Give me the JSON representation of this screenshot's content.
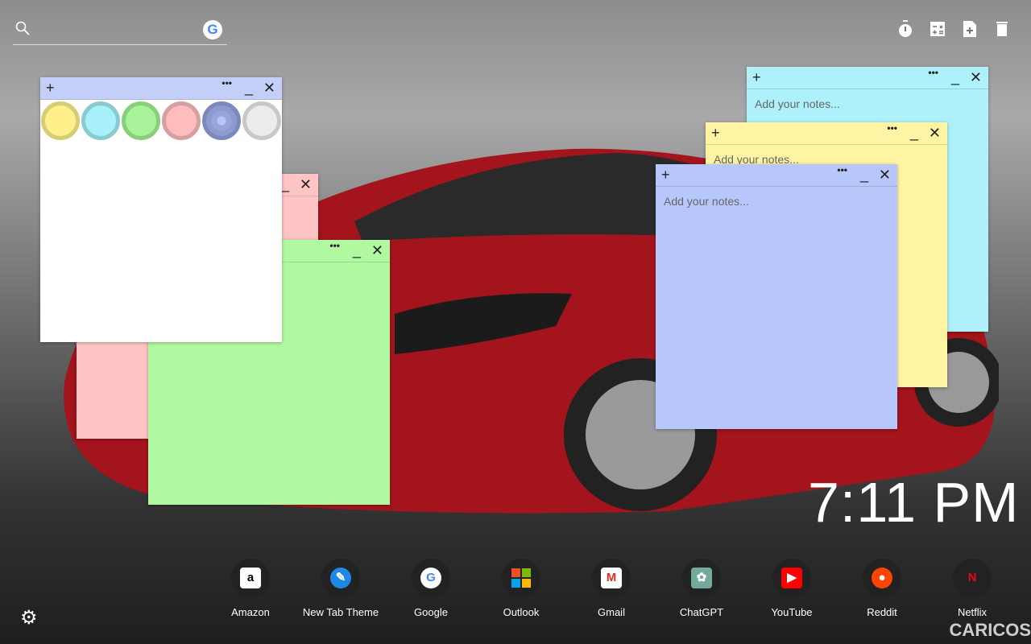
{
  "search": {
    "placeholder": "",
    "engine_icon": "google-icon"
  },
  "toolbar": {
    "icons": [
      "timer-icon",
      "calculator-icon",
      "add-note-icon",
      "trash-icon"
    ]
  },
  "notes": [
    {
      "id": "picker",
      "color": "#ffffff",
      "header": "#c3cff9",
      "value": "",
      "placeholder": ""
    },
    {
      "id": "pink",
      "color": "#ffc4c4",
      "value": "",
      "placeholder": ""
    },
    {
      "id": "green",
      "color": "#b0f9a0",
      "value": "",
      "placeholder": ""
    },
    {
      "id": "cyan",
      "color": "#aef1fb",
      "value": "",
      "placeholder": "Add your notes..."
    },
    {
      "id": "yellow",
      "color": "#fff4a3",
      "value": "",
      "placeholder": "Add your notes..."
    },
    {
      "id": "blue",
      "color": "#b8c7fb",
      "value": "",
      "placeholder": "Add your notes..."
    }
  ],
  "note_controls": {
    "add": "+",
    "more": "•••",
    "minimize": "_",
    "close": "✕"
  },
  "color_swatches": [
    {
      "fill": "#fff08c",
      "ring": "#d6cd77"
    },
    {
      "fill": "#a8f0fa",
      "ring": "#8ccad2"
    },
    {
      "fill": "#a8f29a",
      "ring": "#88cf7c"
    },
    {
      "fill": "#ffbcbc",
      "ring": "#d6a0a0"
    },
    {
      "fill": "#8d9bd0",
      "ring": "#7c89bd",
      "selected": true
    },
    {
      "fill": "#ececec",
      "ring": "#c8c8c8"
    }
  ],
  "clock": {
    "time": "7:11 PM"
  },
  "shortcuts": [
    {
      "label": "Amazon",
      "glyph": "a",
      "bg": "#fff",
      "fg": "#000"
    },
    {
      "label": "New Tab Theme",
      "glyph": "✎",
      "bg": "#1e88e5",
      "fg": "#fff"
    },
    {
      "label": "Google",
      "glyph": "G",
      "bg": "#fff",
      "fg": "#4285f4"
    },
    {
      "label": "Outlook",
      "glyph": "",
      "bg": "#222",
      "fg": "#fff"
    },
    {
      "label": "Gmail",
      "glyph": "M",
      "bg": "#fff",
      "fg": "#d93025"
    },
    {
      "label": "ChatGPT",
      "glyph": "✿",
      "bg": "#74aa9c",
      "fg": "#fff"
    },
    {
      "label": "YouTube",
      "glyph": "▶",
      "bg": "#ff0000",
      "fg": "#fff"
    },
    {
      "label": "Reddit",
      "glyph": "●",
      "bg": "#ff4500",
      "fg": "#fff"
    },
    {
      "label": "Netflix",
      "glyph": "N",
      "bg": "#222",
      "fg": "#e50914"
    }
  ],
  "watermark": "CARICOS"
}
